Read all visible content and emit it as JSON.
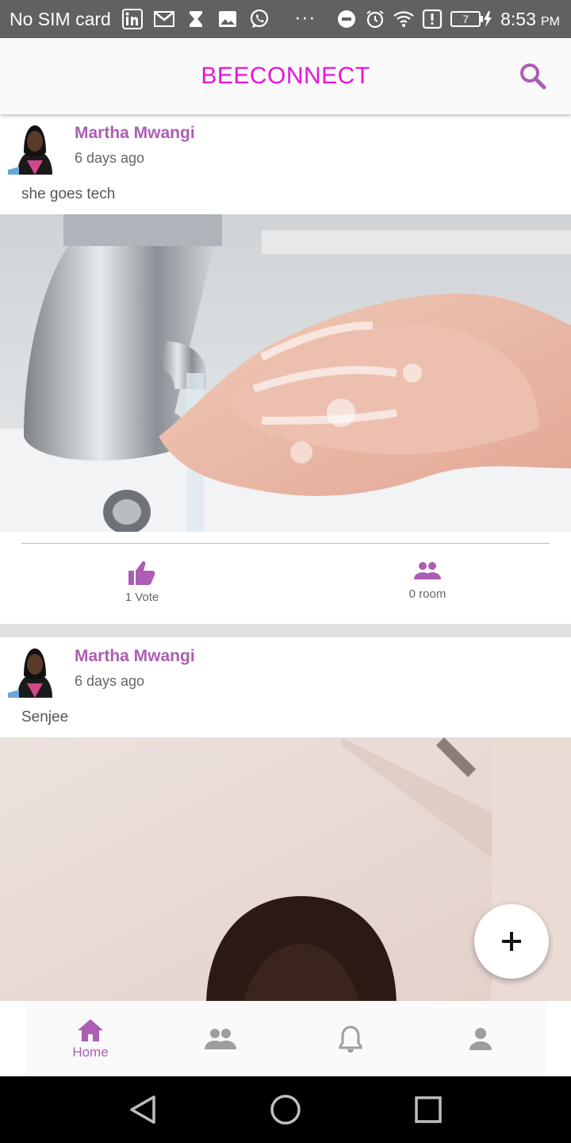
{
  "status_bar": {
    "carrier": "No SIM card",
    "time": "8:53",
    "ampm": "PM",
    "battery": "7",
    "overflow": "···"
  },
  "app_bar": {
    "title": "BEECONNECT",
    "search_icon": "search-icon"
  },
  "posts": [
    {
      "author": "Martha Mwangi",
      "time": "6 days ago",
      "text": "she goes tech",
      "image": "hand-washing-photo",
      "votes_label": "1 Vote",
      "room_label": "0 room"
    },
    {
      "author": "Martha Mwangi",
      "time": "6 days ago",
      "text": "Senjee",
      "image": "portrait-photo"
    }
  ],
  "fab": {
    "icon": "plus-icon"
  },
  "bottom_nav": {
    "items": [
      {
        "label": "Home",
        "icon": "home-icon",
        "active": true
      },
      {
        "label": "",
        "icon": "people-icon",
        "active": false
      },
      {
        "label": "",
        "icon": "bell-icon",
        "active": false
      },
      {
        "label": "",
        "icon": "person-icon",
        "active": false
      }
    ]
  },
  "colors": {
    "accent": "#ad5db4",
    "title": "#e515d8",
    "status_bar": "#616161"
  }
}
